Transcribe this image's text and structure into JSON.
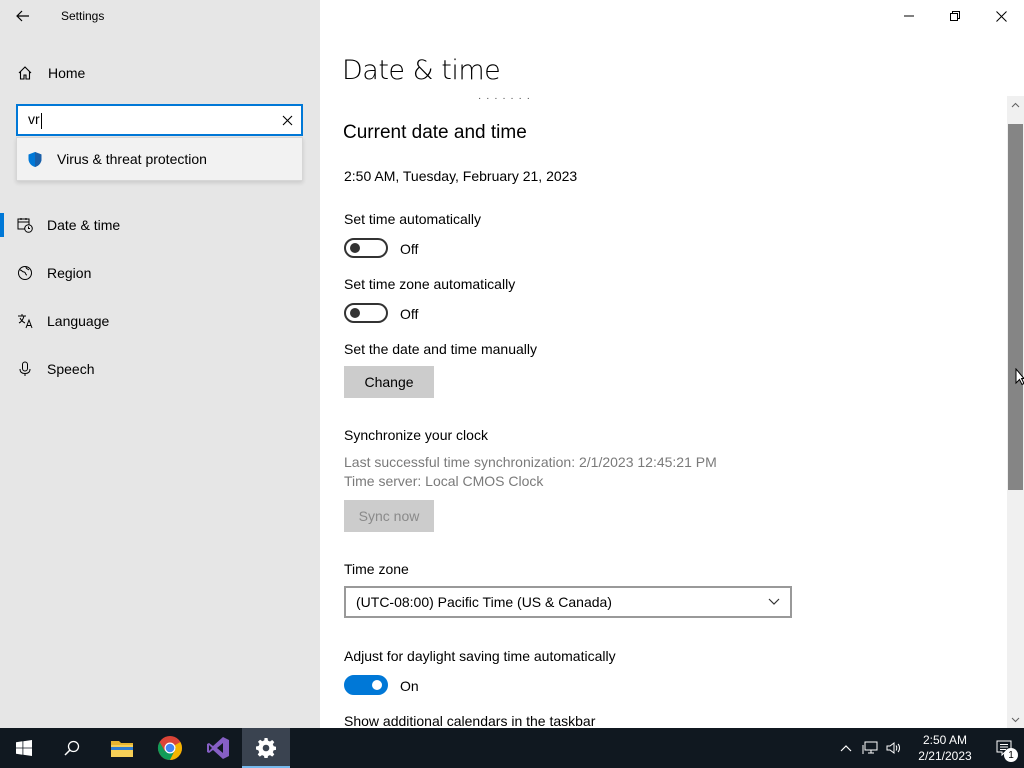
{
  "window": {
    "title": "Settings"
  },
  "sidebar": {
    "home_label": "Home",
    "search": {
      "value": "vr"
    },
    "suggestion": {
      "label": "Virus & threat protection"
    },
    "items": [
      {
        "label": "Date & time",
        "icon": "date-time-icon",
        "active": true
      },
      {
        "label": "Region",
        "icon": "region-icon",
        "active": false
      },
      {
        "label": "Language",
        "icon": "language-icon",
        "active": false
      },
      {
        "label": "Speech",
        "icon": "microphone-icon",
        "active": false
      }
    ]
  },
  "main": {
    "page_title": "Date & time",
    "section_title": "Current date and time",
    "current_datetime": "2:50 AM, Tuesday, February 21, 2023",
    "set_time_auto": {
      "label": "Set time automatically",
      "state": "Off"
    },
    "set_timezone_auto": {
      "label": "Set time zone automatically",
      "state": "Off"
    },
    "manual": {
      "label": "Set the date and time manually",
      "button": "Change"
    },
    "sync": {
      "heading": "Synchronize your clock",
      "last_sync": "Last successful time synchronization: 2/1/2023 12:45:21 PM",
      "server": "Time server: Local CMOS Clock",
      "button": "Sync now"
    },
    "timezone": {
      "label": "Time zone",
      "value": "(UTC-08:00) Pacific Time (US & Canada)"
    },
    "dst": {
      "label": "Adjust for daylight saving time automatically",
      "state": "On"
    },
    "calendars_label": "Show additional calendars in the taskbar"
  },
  "taskbar": {
    "time": "2:50 AM",
    "date": "2/21/2023",
    "notification_count": "1",
    "apps": [
      "start-icon",
      "search-icon",
      "file-explorer-icon",
      "chrome-icon",
      "visual-studio-icon",
      "settings-icon"
    ]
  },
  "colors": {
    "accent": "#0078d7",
    "sidebar_bg": "#e6e6e6",
    "taskbar_bg": "#101820"
  }
}
